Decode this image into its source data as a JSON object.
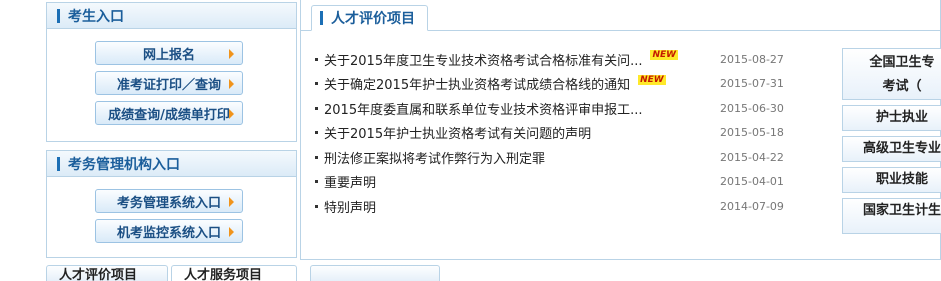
{
  "candidate_panel": {
    "title": "考生入口",
    "buttons": [
      "网上报名",
      "准考证打印／查询",
      "成绩查询/成绩单打印"
    ]
  },
  "exam_admin_panel": {
    "title": "考务管理机构入口",
    "buttons": [
      "考务管理系统入口",
      "机考监控系统入口"
    ]
  },
  "news_panel": {
    "tab_label": "人才评价项目",
    "badge_label": "NEW",
    "items": [
      {
        "title": "关于2015年度卫生专业技术资格考试合格标准有关问...",
        "date": "2015-08-27",
        "is_new": true
      },
      {
        "title": "关于确定2015年护士执业资格考试成绩合格线的通知",
        "date": "2015-07-31",
        "is_new": true
      },
      {
        "title": "2015年度委直属和联系单位专业技术资格评审申报工...",
        "date": "2015-06-30",
        "is_new": false
      },
      {
        "title": "关于2015年护士执业资格考试有关问题的声明",
        "date": "2015-05-18",
        "is_new": false
      },
      {
        "title": "刑法修正案拟将考试作弊行为入刑定罪",
        "date": "2015-04-22",
        "is_new": false
      },
      {
        "title": "重要声明",
        "date": "2015-04-01",
        "is_new": false
      },
      {
        "title": "特别声明",
        "date": "2014-07-09",
        "is_new": false
      }
    ]
  },
  "side_links": {
    "link1_line1": "全国卫生专",
    "link1_line2": "考试（",
    "link2": "护士执业",
    "link3": "高级卫生专业",
    "link4": "职业技能",
    "link5": "国家卫生计生"
  },
  "bottom_tabs": [
    "人才评价项目",
    "人才服务项目"
  ]
}
